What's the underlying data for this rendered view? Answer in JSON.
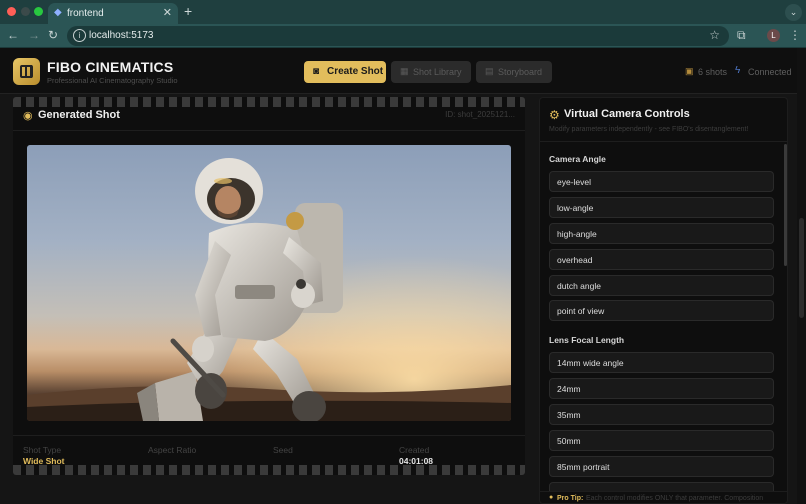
{
  "browser": {
    "tab_title": "frontend",
    "url": "localhost:5173",
    "profile_initial": "L"
  },
  "app": {
    "brand_title": "FIBO CINEMATICS",
    "brand_subtitle": "Professional AI Cinematography Studio",
    "create_shot_label": "Create Shot",
    "shot_library_label": "Shot Library",
    "storyboard_label": "Storyboard",
    "shots_count": "6 shots",
    "connection_status": "Connected",
    "accent_color": "#e2bd5c"
  },
  "shot": {
    "heading": "Generated Shot",
    "shot_id": "ID: shot_2025121...",
    "meta": {
      "type_label": "Shot Type",
      "type_value": "Wide Shot",
      "aspect_label": "Aspect Ratio",
      "seed_label": "Seed",
      "created_label": "Created",
      "created_value": "04:01:08"
    }
  },
  "controls": {
    "title": "Virtual Camera Controls",
    "subtitle": "Modify parameters independently - see FIBO's disentanglement!",
    "camera_angle": {
      "title": "Camera Angle",
      "options": [
        "eye-level",
        "low-angle",
        "high-angle",
        "overhead",
        "dutch angle",
        "point of view"
      ]
    },
    "lens": {
      "title": "Lens Focal Length",
      "options": [
        "14mm wide angle",
        "24mm",
        "35mm",
        "50mm",
        "85mm portrait"
      ]
    },
    "tip_label": "Pro Tip:",
    "tip_text": "Each control modifies ONLY that parameter. Composition"
  }
}
